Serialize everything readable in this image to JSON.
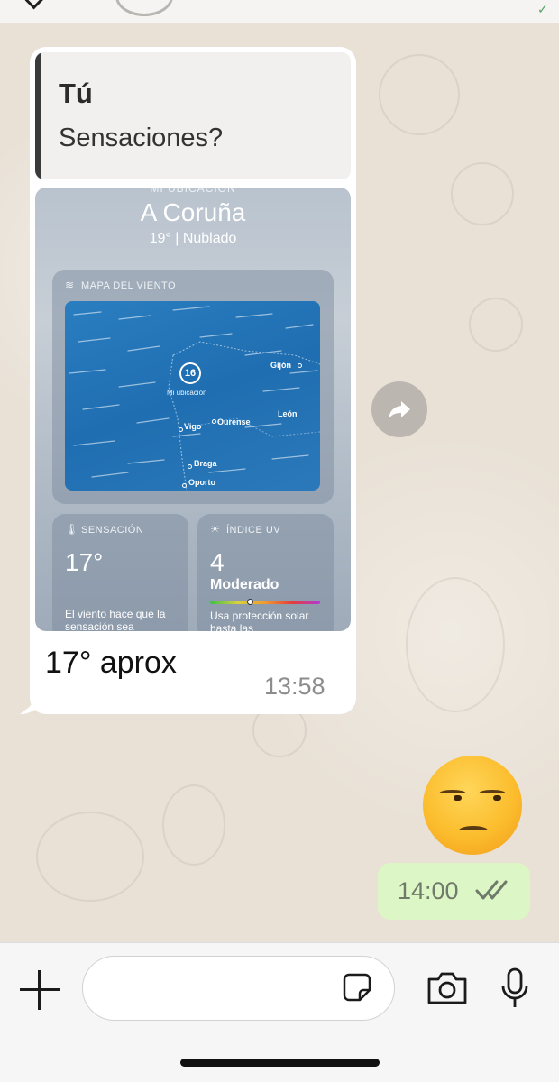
{
  "chat": {
    "quoted": {
      "author": "Tú",
      "text": "Sensaciones?"
    },
    "shared_screenshot": {
      "location_label": "MI UBICACIÓN",
      "city": "A Coruña",
      "conditions": "19°  |  Nublado",
      "wind_card": {
        "title": "MAPA DEL VIENTO",
        "pin_value": "16",
        "pin_label": "Mi ubicación",
        "places": [
          "Gijón",
          "León",
          "Vigo",
          "Ourense",
          "Braga",
          "Oporto"
        ]
      },
      "feels_like_card": {
        "title": "SENSACIÓN",
        "value": "17°",
        "description": "El viento hace que la sensación sea"
      },
      "uv_card": {
        "title": "ÍNDICE UV",
        "value": "4",
        "level": "Moderado",
        "level_fraction": 0.36,
        "description": "Usa protección solar hasta las"
      }
    },
    "incoming_caption": "17° aprox",
    "incoming_time": "13:58",
    "outgoing_emoji": "unamused-face",
    "outgoing_time": "14:00",
    "outgoing_status": "read-double-check"
  },
  "composer": {
    "placeholder": "",
    "icons": [
      "plus-icon",
      "sticker-icon",
      "camera-icon",
      "microphone-icon"
    ]
  },
  "colors": {
    "outgoing_bubble": "#dcf7c5",
    "incoming_bubble": "#ffffff",
    "chat_background": "#e9e1d6",
    "read_ticks": "#6f7a6a"
  }
}
